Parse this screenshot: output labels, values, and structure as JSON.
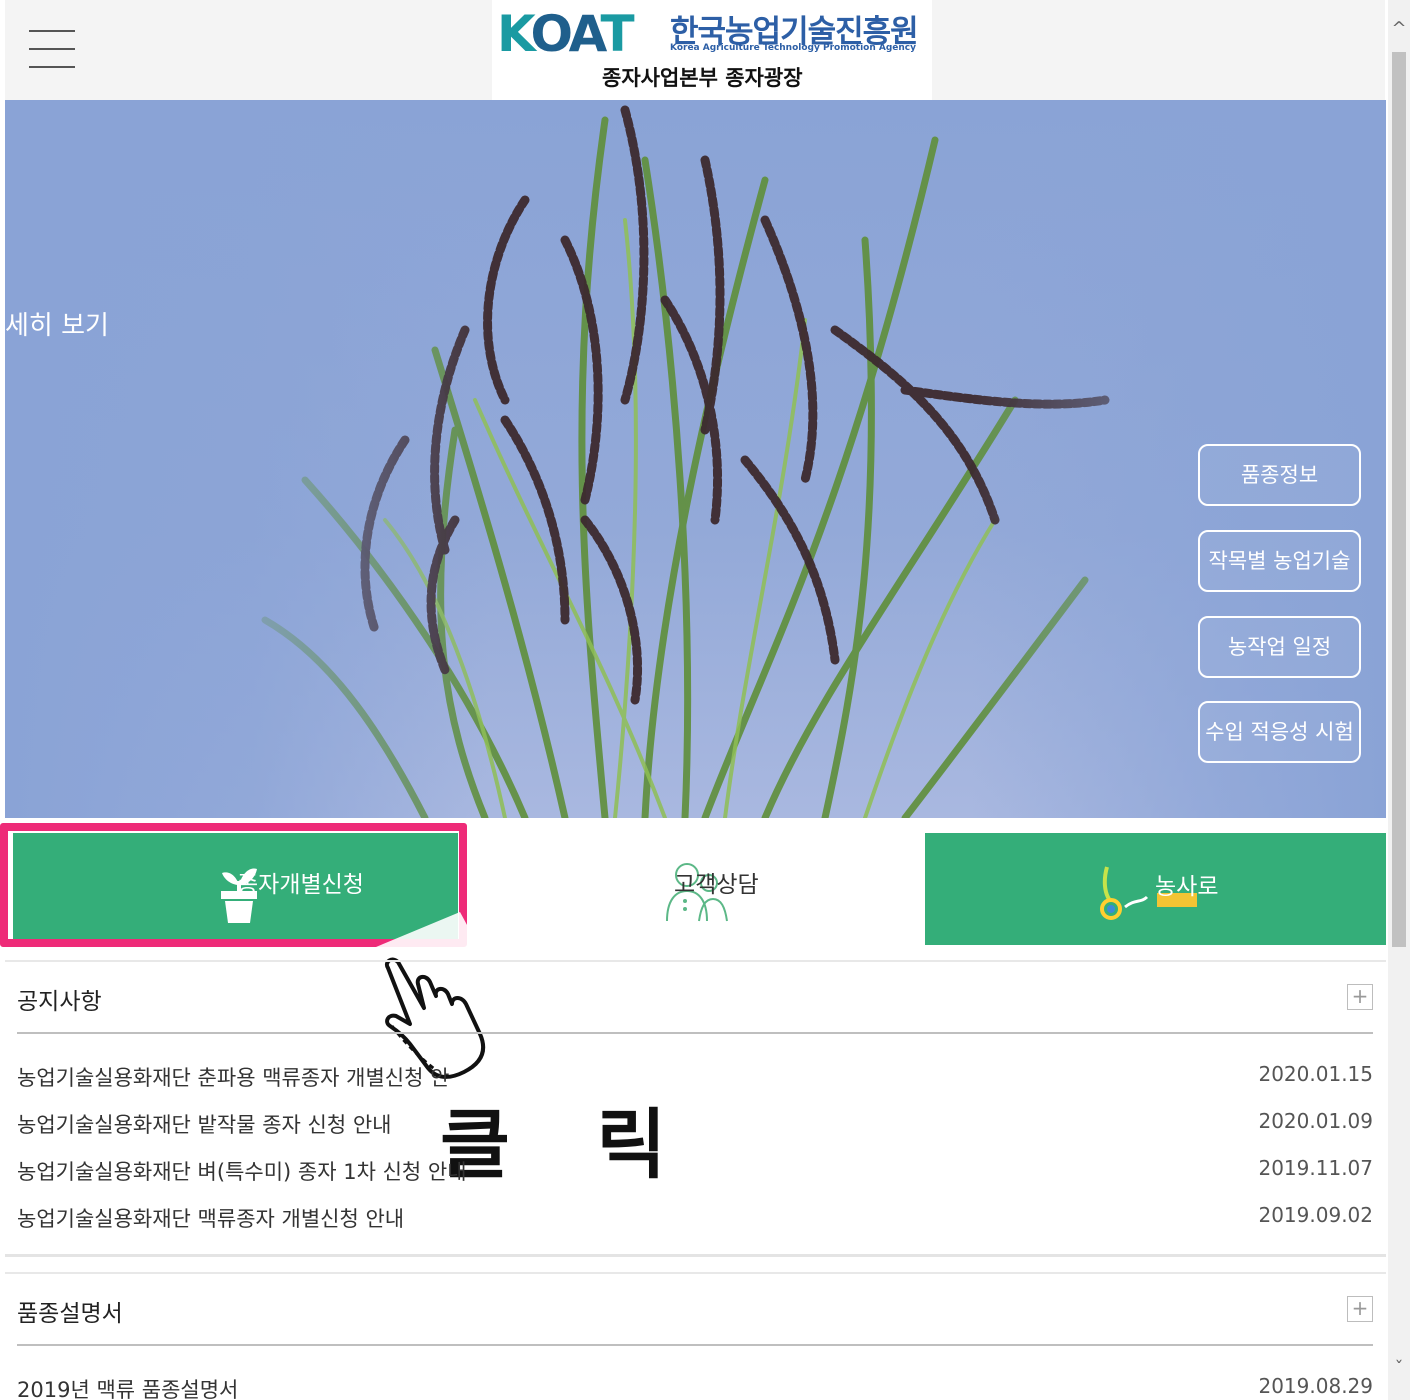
{
  "header": {
    "logo_mark": "KOAT",
    "org_name_kr": "한국농업기술진흥원",
    "org_name_en": "Korea Agriculture Technology Promotion Agency",
    "subtitle": "종자사업본부 종자광장"
  },
  "hero": {
    "detail_link": "세히 보기",
    "side_buttons": [
      "품종정보",
      "작목별 농업기술",
      "농작업 일정",
      "수입 적응성 시험"
    ]
  },
  "quick_menu": {
    "seed_apply": "종자개별신청",
    "consult": "고객상담",
    "farm_road": "농사로"
  },
  "annotation": {
    "click_text": "클 릭"
  },
  "notice": {
    "title": "공지사항",
    "more": "+",
    "items": [
      {
        "title": "농업기술실용화재단 춘파용 맥류종자 개별신청 안",
        "date": "2020.01.15"
      },
      {
        "title": "농업기술실용화재단 밭작물 종자 신청 안내",
        "date": "2020.01.09"
      },
      {
        "title": "농업기술실용화재단 벼(특수미) 종자 1차 신청 안내",
        "date": "2019.11.07"
      },
      {
        "title": "농업기술실용화재단 맥류종자 개별신청 안내",
        "date": "2019.09.02"
      }
    ]
  },
  "variety": {
    "title": "품종설명서",
    "more": "+",
    "items": [
      {
        "title": "2019년 맥류 품종설명서",
        "date": "2019.08.29"
      }
    ]
  },
  "colors": {
    "green": "#34ae79",
    "highlight": "#ee2b78",
    "hero_sky": "#8aa3d6"
  }
}
